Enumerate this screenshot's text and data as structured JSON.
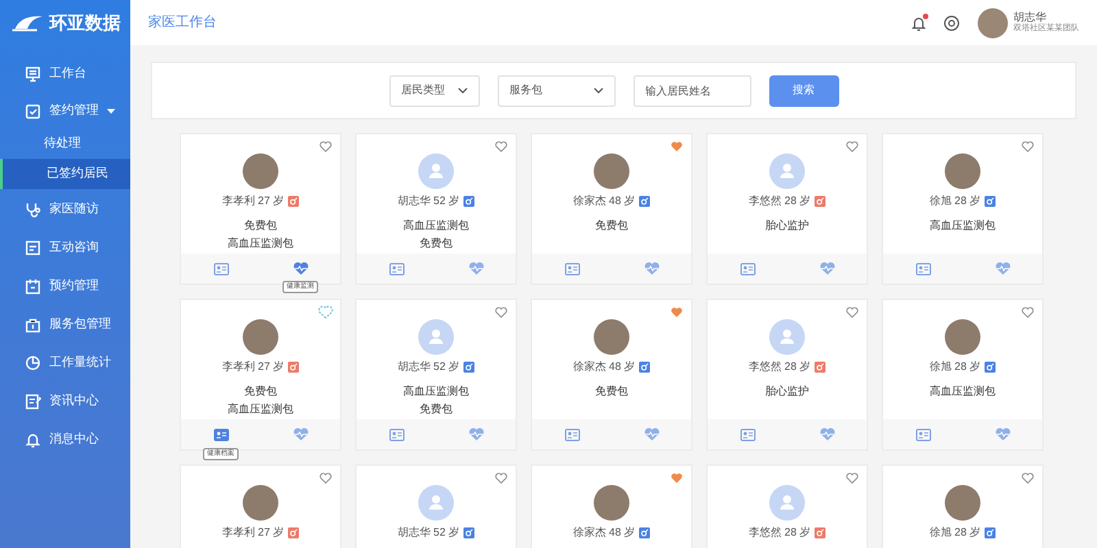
{
  "logo": {
    "text": "环亚数据"
  },
  "sidebar": {
    "items": [
      {
        "label": "工作台",
        "selected": false
      },
      {
        "label": "签约管理",
        "selected": false,
        "expanded": true,
        "children": [
          {
            "label": "待处理",
            "selected": false
          },
          {
            "label": "已签约居民",
            "selected": true
          }
        ]
      },
      {
        "label": "家医随访",
        "selected": false
      },
      {
        "label": "互动咨询",
        "selected": false
      },
      {
        "label": "预约管理",
        "selected": false
      },
      {
        "label": "服务包管理",
        "selected": false
      },
      {
        "label": "工作量统计",
        "selected": false
      },
      {
        "label": "资讯中心",
        "selected": false
      },
      {
        "label": "消息中心",
        "selected": false
      }
    ]
  },
  "header": {
    "title": "家医工作台",
    "notification_dot": true,
    "user": {
      "name": "胡志华",
      "team": "双塔社区某某团队"
    }
  },
  "filters": {
    "resident_type": "居民类型",
    "package": "服务包",
    "name_placeholder": "输入居民姓名",
    "search_button": "搜索"
  },
  "cards": [
    {
      "name": "李孝利",
      "age": "27 岁",
      "color": "#ee7a68",
      "kind": "photo",
      "favorite": false,
      "heart_hover": false,
      "packages": [
        "免费包",
        "高血压监测包"
      ],
      "monitor_tooltip": "健康监测"
    },
    {
      "name": "胡志华",
      "age": "52 岁",
      "color": "#4b82e3",
      "kind": "default",
      "favorite": false,
      "heart_hover": false,
      "packages": [
        "高血压监测包",
        "免费包"
      ]
    },
    {
      "name": "徐家杰",
      "age": "48 岁",
      "color": "#4b82e3",
      "kind": "photo",
      "favorite": true,
      "heart_hover": false,
      "packages": [
        "免费包"
      ]
    },
    {
      "name": "李悠然",
      "age": "28 岁",
      "color": "#ee7a68",
      "kind": "default",
      "favorite": false,
      "heart_hover": false,
      "packages": [
        "胎心监护"
      ]
    },
    {
      "name": "徐旭",
      "age": "28 岁",
      "color": "#4b82e3",
      "kind": "photo",
      "favorite": false,
      "heart_hover": false,
      "packages": [
        "高血压监测包"
      ]
    },
    {
      "name": "李孝利",
      "age": "27 岁",
      "color": "#ee7a68",
      "kind": "photo",
      "favorite": false,
      "heart_hover": true,
      "packages": [
        "免费包",
        "高血压监测包"
      ],
      "profile_tooltip": "健康档案"
    },
    {
      "name": "胡志华",
      "age": "52 岁",
      "color": "#4b82e3",
      "kind": "default",
      "favorite": false,
      "heart_hover": false,
      "packages": [
        "高血压监测包",
        "免费包"
      ]
    },
    {
      "name": "徐家杰",
      "age": "48 岁",
      "color": "#4b82e3",
      "kind": "photo",
      "favorite": true,
      "heart_hover": false,
      "packages": [
        "免费包"
      ]
    },
    {
      "name": "李悠然",
      "age": "28 岁",
      "color": "#ee7a68",
      "kind": "default",
      "favorite": false,
      "heart_hover": false,
      "packages": [
        "胎心监护"
      ]
    },
    {
      "name": "徐旭",
      "age": "28 岁",
      "color": "#4b82e3",
      "kind": "photo",
      "favorite": false,
      "heart_hover": false,
      "packages": [
        "高血压监测包"
      ]
    },
    {
      "name": "李孝利",
      "age": "27 岁",
      "color": "#ee7a68",
      "kind": "photo",
      "favorite": false,
      "heart_hover": false
    },
    {
      "name": "胡志华",
      "age": "52 岁",
      "color": "#4b82e3",
      "kind": "default",
      "favorite": false,
      "heart_hover": false
    },
    {
      "name": "徐家杰",
      "age": "48 岁",
      "color": "#4b82e3",
      "kind": "photo",
      "favorite": true,
      "heart_hover": false
    },
    {
      "name": "李悠然",
      "age": "28 岁",
      "color": "#ee7a68",
      "kind": "default",
      "favorite": false,
      "heart_hover": false
    },
    {
      "name": "徐旭",
      "age": "28 岁",
      "color": "#4b82e3",
      "kind": "photo",
      "favorite": false,
      "heart_hover": false
    }
  ]
}
